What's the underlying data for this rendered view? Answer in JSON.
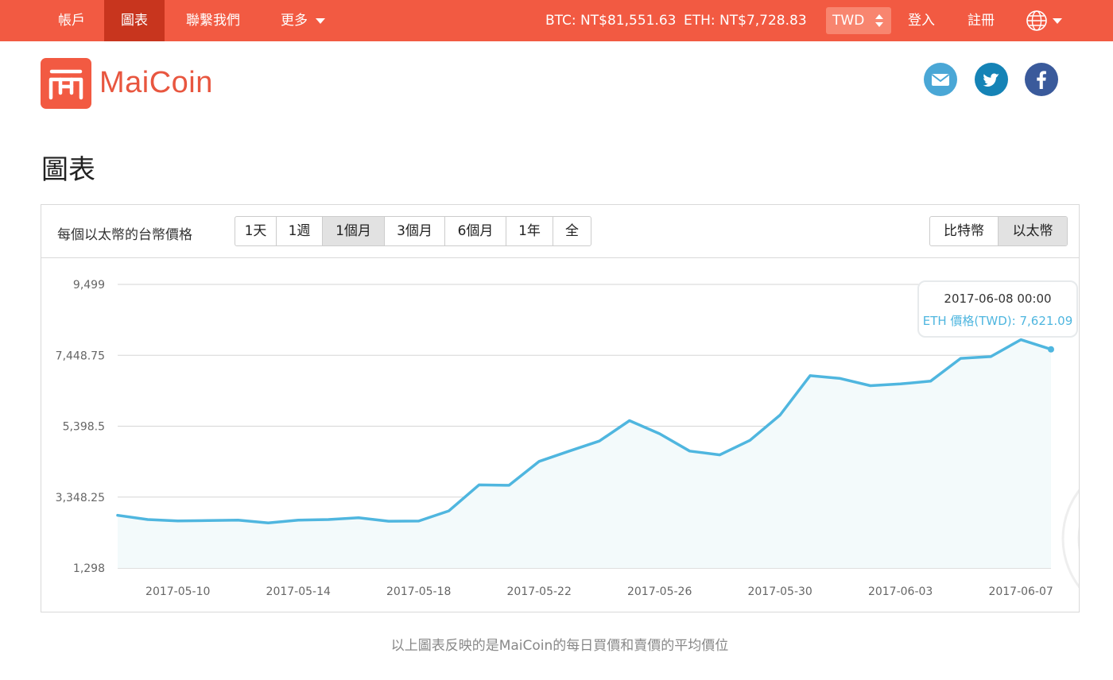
{
  "nav": {
    "items": [
      {
        "label": "帳戶"
      },
      {
        "label": "圖表"
      },
      {
        "label": "聯繫我們"
      },
      {
        "label": "更多"
      }
    ],
    "btc_ticker": "BTC: NT$81,551.63",
    "eth_ticker": "ETH: NT$7,728.83",
    "currency": "TWD",
    "login": "登入",
    "register": "註冊",
    "language_icon": "globe-icon"
  },
  "brand": {
    "name": "MaiCoin",
    "color": "#f25a42"
  },
  "social": {
    "mail_icon": "mail-icon",
    "twitter_icon": "twitter-icon",
    "facebook_icon": "facebook-icon"
  },
  "page": {
    "title": "圖表",
    "footnote": "以上圖表反映的是MaiCoin的每日買價和賣價的平均價位"
  },
  "chart_panel": {
    "title": "每個以太幣的台幣價格",
    "ranges": [
      "1天",
      "1週",
      "1個月",
      "3個月",
      "6個月",
      "1年",
      "全"
    ],
    "active_range": "1個月",
    "coins": [
      "比特幣",
      "以太幣"
    ],
    "active_coin": "以太幣"
  },
  "tooltip": {
    "date": "2017-06-08 00:00",
    "value": "ETH 價格(TWD): 7,621.09"
  },
  "colors": {
    "nav_bg": "#f25a42",
    "nav_active": "#c8351e",
    "line": "#4fb6df",
    "area": "#f3fafb"
  },
  "chart_data": {
    "type": "area",
    "x": [
      "2017-05-08",
      "2017-05-09",
      "2017-05-10",
      "2017-05-11",
      "2017-05-12",
      "2017-05-13",
      "2017-05-14",
      "2017-05-15",
      "2017-05-16",
      "2017-05-17",
      "2017-05-18",
      "2017-05-19",
      "2017-05-20",
      "2017-05-21",
      "2017-05-22",
      "2017-05-23",
      "2017-05-24",
      "2017-05-25",
      "2017-05-26",
      "2017-05-27",
      "2017-05-28",
      "2017-05-29",
      "2017-05-30",
      "2017-05-31",
      "2017-06-01",
      "2017-06-02",
      "2017-06-03",
      "2017-06-04",
      "2017-06-05",
      "2017-06-06",
      "2017-06-07",
      "2017-06-08"
    ],
    "values": [
      2820,
      2700,
      2660,
      2670,
      2680,
      2600,
      2680,
      2700,
      2750,
      2650,
      2655,
      2950,
      3700,
      3690,
      4380,
      4680,
      4970,
      5560,
      5180,
      4680,
      4570,
      4990,
      5720,
      6860,
      6780,
      6570,
      6620,
      6700,
      7360,
      7410,
      7900,
      7621.09
    ],
    "xticks": [
      "2017-05-10",
      "2017-05-14",
      "2017-05-18",
      "2017-05-22",
      "2017-05-26",
      "2017-05-30",
      "2017-06-03",
      "2017-06-07"
    ],
    "yticks": [
      "1,298",
      "3,348.25",
      "5,398.5",
      "7,448.75",
      "9,499"
    ],
    "ylim": [
      1298,
      9499
    ]
  }
}
